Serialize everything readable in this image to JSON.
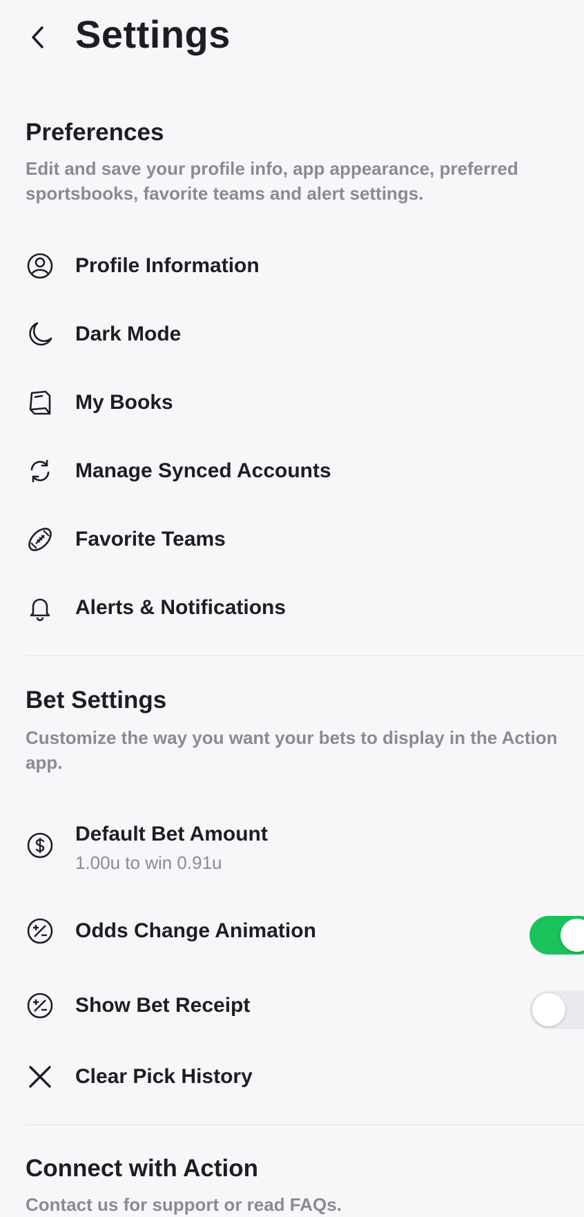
{
  "header": {
    "title": "Settings",
    "back_icon": "chevron-left-icon"
  },
  "preferences": {
    "title": "Preferences",
    "description": "Edit and save your profile info, app appearance, preferred sportsbooks, favorite teams and alert settings.",
    "items": [
      {
        "label": "Profile Information",
        "icon": "user-circle-icon"
      },
      {
        "label": "Dark Mode",
        "icon": "moon-icon"
      },
      {
        "label": "My Books",
        "icon": "book-icon"
      },
      {
        "label": "Manage Synced Accounts",
        "icon": "sync-icon"
      },
      {
        "label": "Favorite Teams",
        "icon": "football-icon"
      },
      {
        "label": "Alerts & Notifications",
        "icon": "bell-icon"
      }
    ]
  },
  "bet_settings": {
    "title": "Bet Settings",
    "description": "Customize the way you want your bets to display in the Action app.",
    "default_bet": {
      "label": "Default Bet Amount",
      "value": "1.00u to win 0.91u",
      "icon": "dollar-circle-icon"
    },
    "odds_change": {
      "label": "Odds Change Animation",
      "icon": "odds-icon",
      "enabled": true
    },
    "show_receipt": {
      "label": "Show Bet Receipt",
      "icon": "odds-icon",
      "enabled": false
    },
    "clear_history": {
      "label": "Clear Pick History",
      "icon": "close-icon"
    }
  },
  "connect": {
    "title": "Connect with Action",
    "description": "Contact us for support or read FAQs."
  },
  "colors": {
    "toggle_on": "#18c35b",
    "toggle_off": "#e9e9ee",
    "text_primary": "#1d1d22",
    "text_secondary": "#8a8a93",
    "background": "#f7f7fa"
  }
}
